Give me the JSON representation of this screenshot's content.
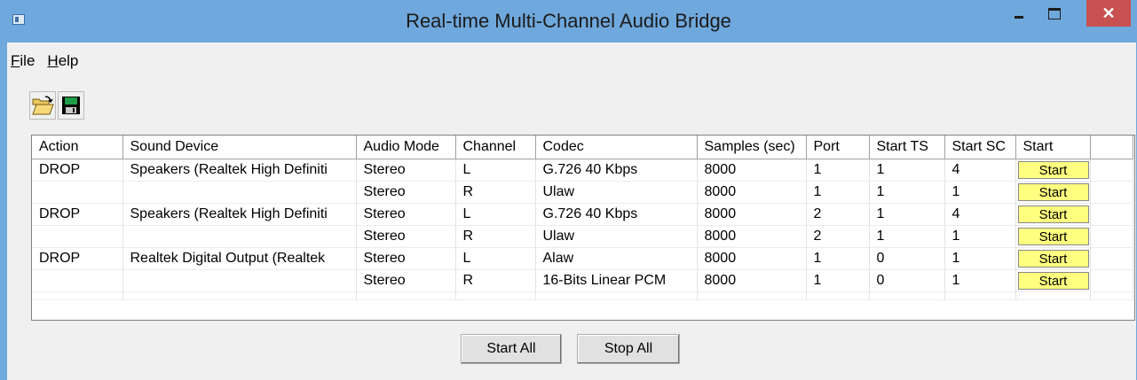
{
  "window": {
    "title": "Real-time Multi-Channel Audio Bridge"
  },
  "menu": [
    {
      "first": "F",
      "rest": "ile"
    },
    {
      "first": "H",
      "rest": "elp"
    }
  ],
  "toolbar": {
    "open_icon": "folder-open-icon",
    "save_icon": "floppy-disk-icon"
  },
  "table": {
    "columns": [
      "Action",
      "Sound Device",
      "Audio Mode",
      "Channel",
      "Codec",
      "Samples (sec)",
      "Port",
      "Start TS",
      "Start SC",
      "Start"
    ],
    "rows": [
      [
        "DROP",
        "Speakers (Realtek High Definiti",
        "Stereo",
        "L",
        "G.726 40 Kbps",
        "8000",
        "1",
        "1",
        "4",
        "Start"
      ],
      [
        "",
        "",
        "Stereo",
        "R",
        "Ulaw",
        "8000",
        "1",
        "1",
        "1",
        "Start"
      ],
      [
        "DROP",
        "Speakers (Realtek High Definiti",
        "Stereo",
        "L",
        "G.726 40 Kbps",
        "8000",
        "2",
        "1",
        "4",
        "Start"
      ],
      [
        "",
        "",
        "Stereo",
        "R",
        "Ulaw",
        "8000",
        "2",
        "1",
        "1",
        "Start"
      ],
      [
        "DROP",
        "Realtek Digital Output (Realtek",
        "Stereo",
        "L",
        "Alaw",
        "8000",
        "1",
        "0",
        "1",
        "Start"
      ],
      [
        "",
        "",
        "Stereo",
        "R",
        "16-Bits Linear PCM",
        "8000",
        "1",
        "0",
        "1",
        "Start"
      ]
    ]
  },
  "buttons": {
    "start_all": "Start All",
    "stop_all": "Stop All"
  },
  "colors": {
    "titlebar": "#6fa8dc",
    "close": "#c75050",
    "start_button": "#ffff80"
  }
}
